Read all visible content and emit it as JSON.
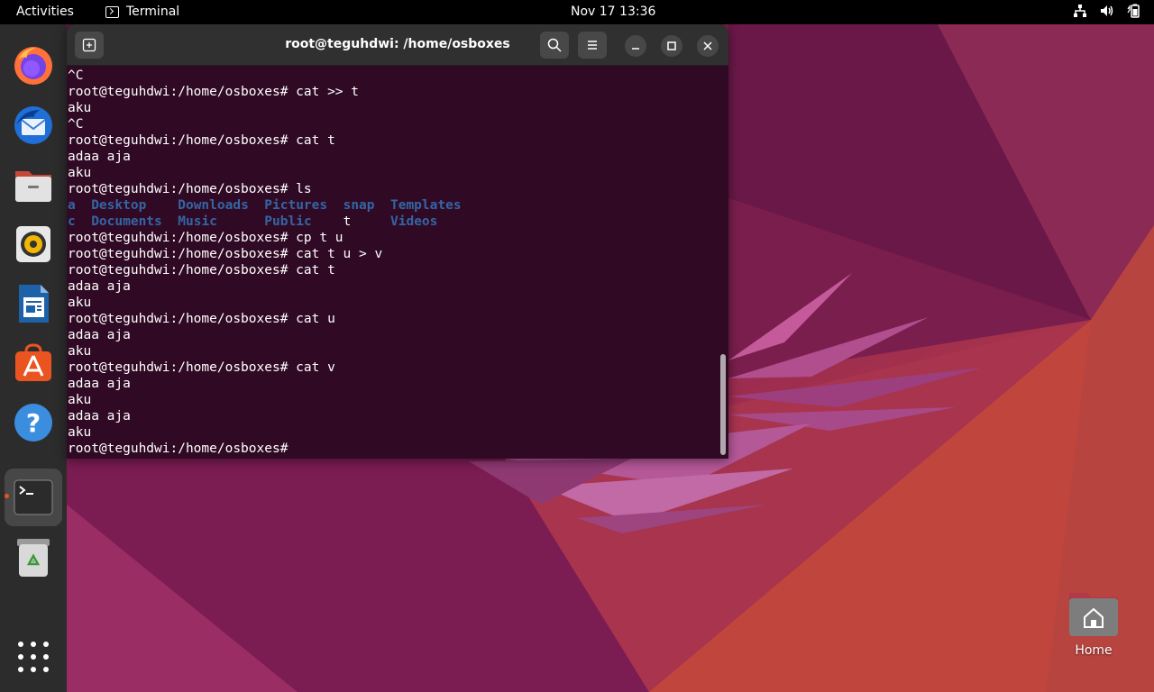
{
  "topbar": {
    "activities": "Activities",
    "app_name": "Terminal",
    "clock": "Nov 17  13:36",
    "tray_icons": [
      "network-icon",
      "volume-icon",
      "battery-icon"
    ]
  },
  "dock": {
    "items": [
      "firefox-icon",
      "thunderbird-icon",
      "files-icon",
      "rhythmbox-icon",
      "libreoffice-writer-icon",
      "app-center-icon",
      "help-icon",
      "terminal-icon",
      "trash-icon",
      "show-apps-icon"
    ],
    "running_indicator_color": "#e95420"
  },
  "terminal": {
    "title": "root@teguhdwi: /home/osboxes",
    "background": "#300a24",
    "directory_color": "#3465a4",
    "lines": [
      "^C",
      "root@teguhdwi:/home/osboxes# cat >> t",
      "aku",
      "^C",
      "root@teguhdwi:/home/osboxes# cat t",
      "adaa aja",
      "aku",
      "root@teguhdwi:/home/osboxes# ls",
      "__LS1__",
      "__LS2__",
      "root@teguhdwi:/home/osboxes# cp t u",
      "root@teguhdwi:/home/osboxes# cat t u > v",
      "root@teguhdwi:/home/osboxes# cat t",
      "adaa aja",
      "aku",
      "root@teguhdwi:/home/osboxes# cat u",
      "adaa aja",
      "aku",
      "root@teguhdwi:/home/osboxes# cat v",
      "adaa aja",
      "aku",
      "adaa aja",
      "aku",
      "root@teguhdwi:/home/osboxes# "
    ],
    "ls_row1": [
      {
        "text": "a",
        "dir": true
      },
      {
        "text": "  ",
        "dir": false
      },
      {
        "text": "Desktop",
        "dir": true
      },
      {
        "text": "    ",
        "dir": false
      },
      {
        "text": "Downloads",
        "dir": true
      },
      {
        "text": "  ",
        "dir": false
      },
      {
        "text": "Pictures",
        "dir": true
      },
      {
        "text": "  ",
        "dir": false
      },
      {
        "text": "snap",
        "dir": true
      },
      {
        "text": "  ",
        "dir": false
      },
      {
        "text": "Templates",
        "dir": true
      }
    ],
    "ls_row2": [
      {
        "text": "c",
        "dir": true
      },
      {
        "text": "  ",
        "dir": false
      },
      {
        "text": "Documents",
        "dir": true
      },
      {
        "text": "  ",
        "dir": false
      },
      {
        "text": "Music",
        "dir": true
      },
      {
        "text": "      ",
        "dir": false
      },
      {
        "text": "Public",
        "dir": true
      },
      {
        "text": "    ",
        "dir": false
      },
      {
        "text": "t",
        "dir": false
      },
      {
        "text": "     ",
        "dir": false
      },
      {
        "text": "Videos",
        "dir": true
      }
    ]
  },
  "desktop": {
    "home_label": "Home"
  }
}
